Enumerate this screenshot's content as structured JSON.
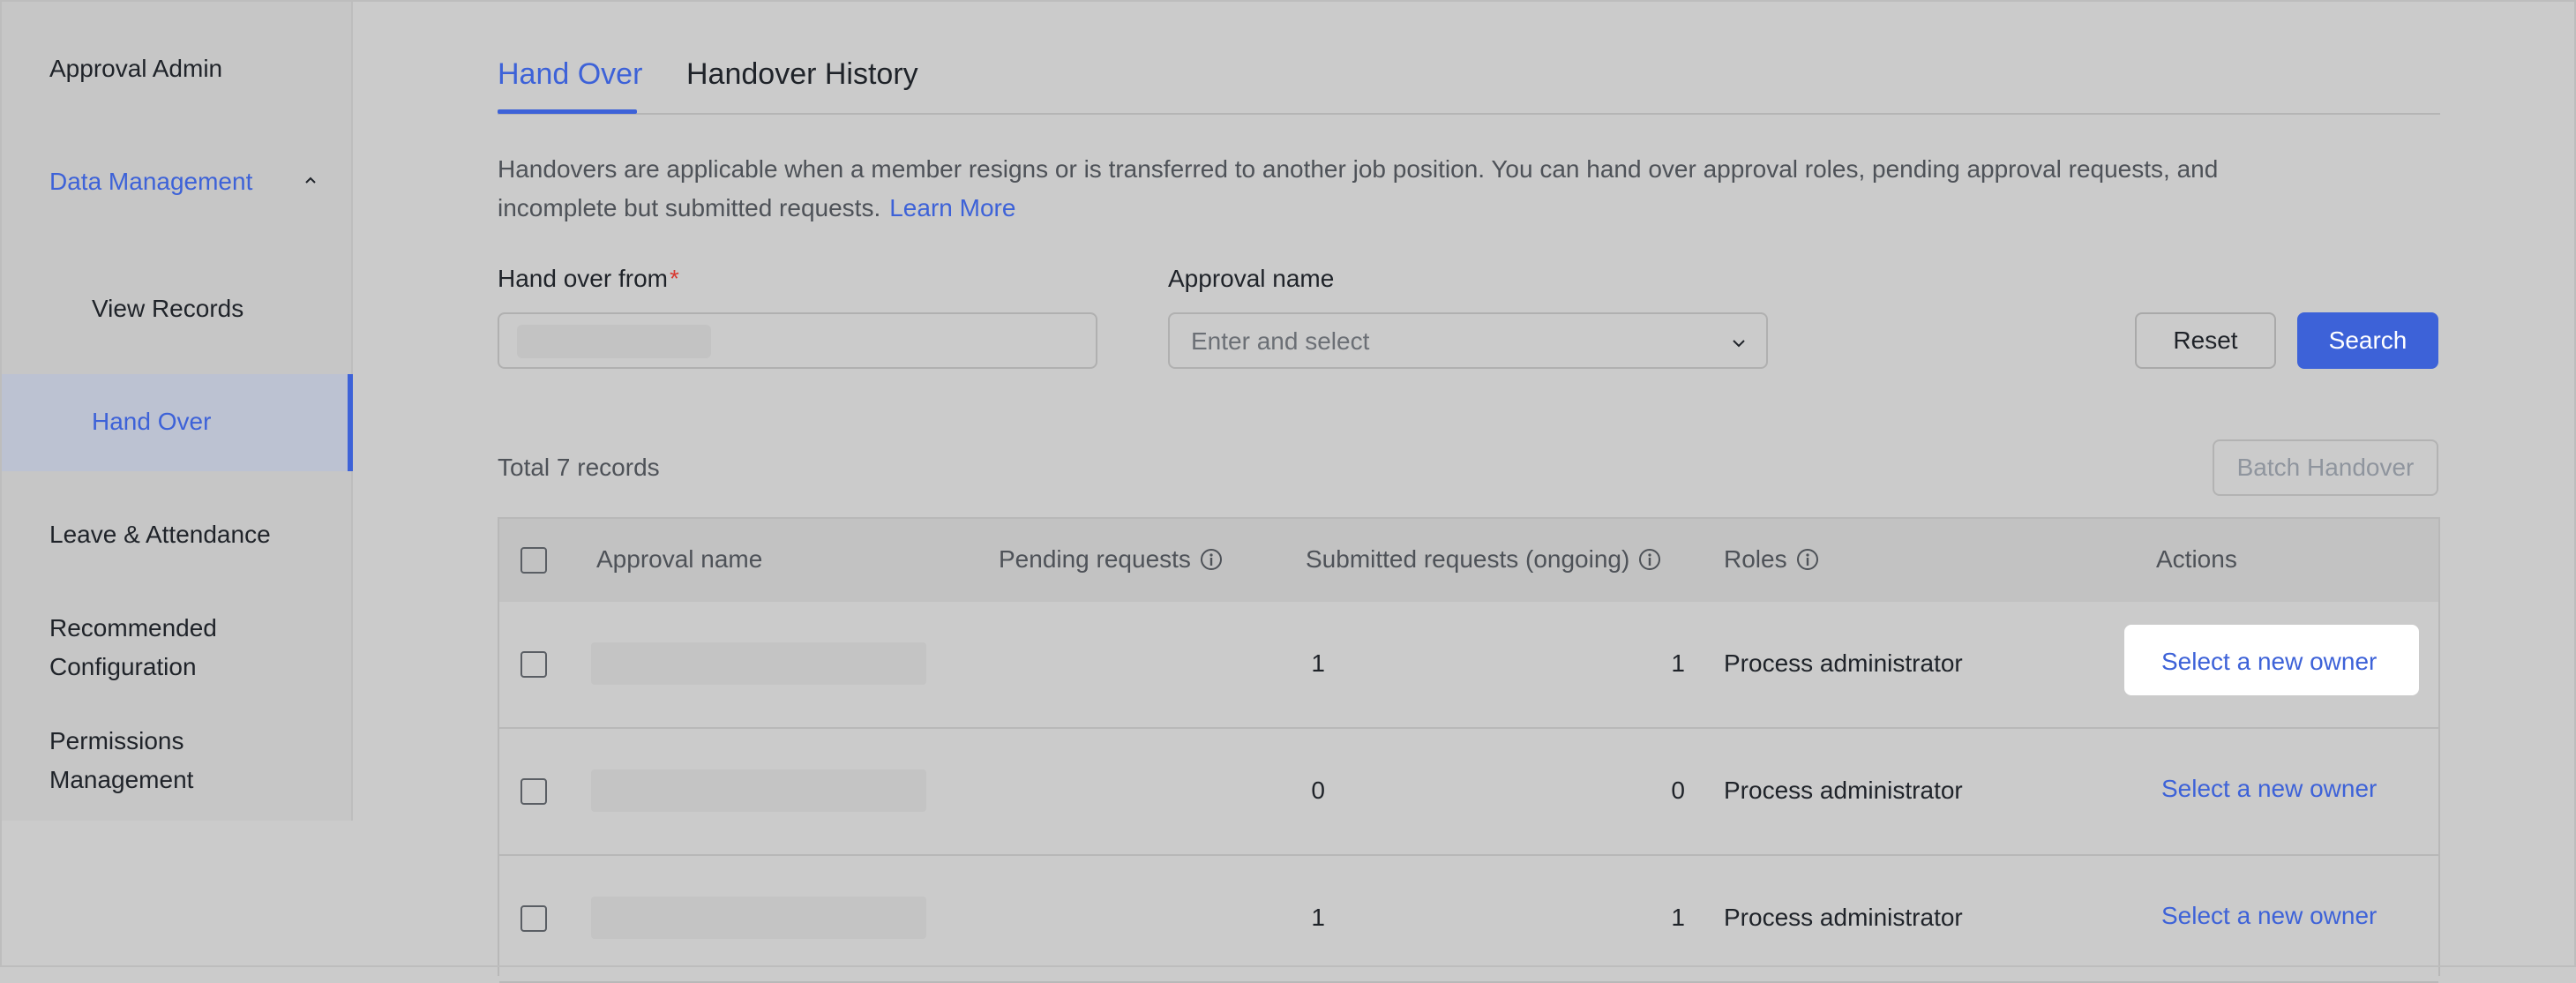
{
  "sidebar": {
    "items": [
      {
        "label": "Approval Admin"
      },
      {
        "label": "Data Management"
      },
      {
        "label": "View Records"
      },
      {
        "label": "Hand Over"
      },
      {
        "label": "Leave & Attendance"
      },
      {
        "label": "Recommended"
      },
      {
        "label": "Configuration"
      },
      {
        "label": "Permissions"
      },
      {
        "label": "Management"
      }
    ],
    "active_item": "Hand Over",
    "expanded_group": "Data Management"
  },
  "tabs": {
    "items": [
      {
        "label": "Hand Over",
        "active": true
      },
      {
        "label": "Handover History",
        "active": false
      }
    ]
  },
  "description": {
    "line1": "Handovers are applicable when a member resigns or is transferred to another job position. You can hand over approval roles, pending approval requests, and",
    "line2": "incomplete but submitted requests.",
    "link": "Learn More"
  },
  "filters": {
    "from_label": "Hand over from",
    "required_mark": "*",
    "approval_label": "Approval name",
    "approval_placeholder": "Enter and select",
    "reset_label": "Reset",
    "search_label": "Search"
  },
  "summary": {
    "total": "Total 7 records",
    "batch_label": "Batch Handover"
  },
  "table": {
    "headers": {
      "name": "Approval name",
      "pending": "Pending requests",
      "submitted": "Submitted requests (ongoing)",
      "roles": "Roles",
      "actions": "Actions"
    },
    "rows": [
      {
        "pending": "1",
        "submitted": "1",
        "role": "Process administrator",
        "action": "Select a new owner"
      },
      {
        "pending": "0",
        "submitted": "0",
        "role": "Process administrator",
        "action": "Select a new owner"
      },
      {
        "pending": "1",
        "submitted": "1",
        "role": "Process administrator",
        "action": "Select a new owner"
      }
    ]
  },
  "colors": {
    "accent": "#3d62d8",
    "required": "#d83931",
    "background": "#cbcbcb"
  },
  "icons": [
    "chevron-up-icon",
    "chevron-down-icon",
    "info-icon",
    "checkbox-icon"
  ]
}
